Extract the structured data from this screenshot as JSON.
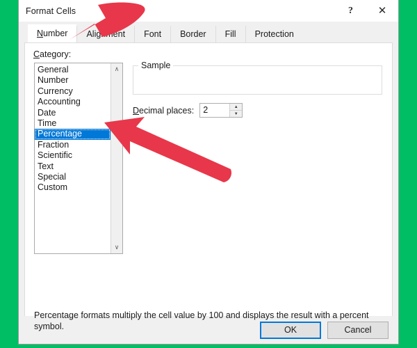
{
  "window": {
    "title": "Format Cells",
    "help_button": "?",
    "close_button": "✕"
  },
  "tabs": [
    {
      "label": "Number",
      "accel": "N",
      "active": true
    },
    {
      "label": "Alignment",
      "accel": "",
      "active": false
    },
    {
      "label": "Font",
      "accel": "",
      "active": false
    },
    {
      "label": "Border",
      "accel": "",
      "active": false
    },
    {
      "label": "Fill",
      "accel": "",
      "active": false
    },
    {
      "label": "Protection",
      "accel": "",
      "active": false
    }
  ],
  "category": {
    "label_prefix": "C",
    "label_rest": "ategory:",
    "items": [
      {
        "label": "General",
        "selected": false
      },
      {
        "label": "Number",
        "selected": false
      },
      {
        "label": "Currency",
        "selected": false
      },
      {
        "label": "Accounting",
        "selected": false
      },
      {
        "label": "Date",
        "selected": false
      },
      {
        "label": "Time",
        "selected": false
      },
      {
        "label": "Percentage",
        "selected": true
      },
      {
        "label": "Fraction",
        "selected": false
      },
      {
        "label": "Scientific",
        "selected": false
      },
      {
        "label": "Text",
        "selected": false
      },
      {
        "label": "Special",
        "selected": false
      },
      {
        "label": "Custom",
        "selected": false
      }
    ],
    "scroll_up": "∧",
    "scroll_down": "∨"
  },
  "sample": {
    "legend": "Sample",
    "value": ""
  },
  "decimal": {
    "label_prefix": "D",
    "label_rest": "ecimal places:",
    "value": "2",
    "spin_up": "▲",
    "spin_down": "▼"
  },
  "description": "Percentage formats multiply the cell value by 100 and displays the result with a percent symbol.",
  "footer": {
    "ok_label": "OK",
    "cancel_label": "Cancel"
  },
  "colors": {
    "background_green": "#00be64",
    "annotation_red": "#e8374a",
    "selection_blue": "#0078d7",
    "dialog_gray": "#f0f0f0"
  },
  "annotations": [
    {
      "name": "arrow-to-number-tab",
      "target": "Number tab"
    },
    {
      "name": "arrow-to-percentage-item",
      "target": "Percentage list item"
    }
  ]
}
